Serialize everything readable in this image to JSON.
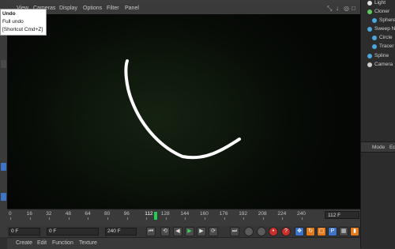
{
  "menu": {
    "items": [
      "View",
      "Cameras",
      "Display",
      "Options",
      "Filter",
      "Panel"
    ],
    "view_icons": [
      "⤡",
      "↓",
      "◎",
      "□"
    ]
  },
  "tooltip": {
    "title": "Undo",
    "line1": "Full undo",
    "line2": "[Shortcut Cmd+Z]"
  },
  "timeline": {
    "ticks": [
      "0",
      "16",
      "32",
      "48",
      "64",
      "80",
      "96",
      "112",
      "128",
      "144",
      "160",
      "176",
      "192",
      "208",
      "224",
      "240"
    ],
    "current_frame": "112",
    "frame_display": "112 F"
  },
  "transport": {
    "start_frame": "0 F",
    "min_field": "0 F",
    "max_field": "240 F",
    "end_frame": "240 F"
  },
  "bottom_bar": {
    "items": [
      "Create",
      "Edit",
      "Function",
      "Texture"
    ]
  },
  "object_manager": {
    "items": [
      {
        "label": "Light",
        "color": "#e0e0e0"
      },
      {
        "label": "Cloner",
        "color": "#5ec95e"
      },
      {
        "label": "Sphere",
        "color": "#4aa8e0"
      },
      {
        "label": "Sweep N",
        "color": "#4aa8e0"
      },
      {
        "label": "Circle",
        "color": "#4aa8e0"
      },
      {
        "label": "Tracer",
        "color": "#4aa8e0"
      },
      {
        "label": "Spline",
        "color": "#4aa8e0"
      },
      {
        "label": "Camera",
        "color": "#cfcfcf"
      }
    ]
  },
  "attributes": {
    "mode_label": "Mode",
    "edit_label": "Ed"
  },
  "colors": {
    "playhead": "#21d04e",
    "record": "#c9302c"
  }
}
